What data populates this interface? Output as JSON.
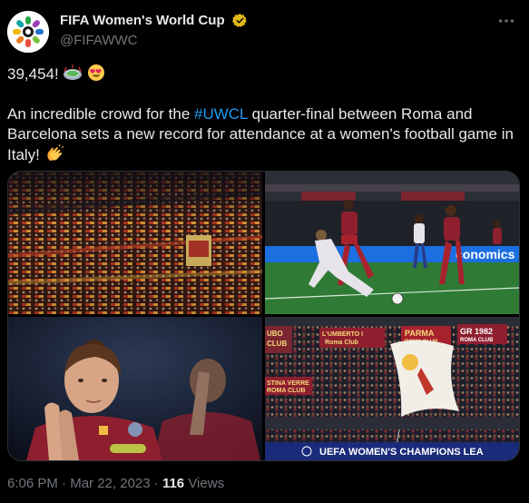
{
  "author": {
    "display_name": "FIFA Women's World Cup",
    "handle": "@FIFAWWC",
    "verified_color": "#e2b719"
  },
  "tweet": {
    "line1": "39,454!",
    "text_before": "An incredible crowd for the ",
    "hashtag": "#UWCL",
    "text_after": " quarter-final between Roma and Barcelona sets a new record for attendance at a women's football game in Italy!"
  },
  "images": {
    "ad_board_1": "conomics",
    "ad_board_2": "UEFA WOMEN'S CHAMPIONS LEA",
    "banner_1": "L'UMBERTO I\nRoma Club",
    "banner_2": "PARMA\nROMA CLUB",
    "banner_3": "GR 1982\nROMA CLUB",
    "banner_4": "UBO\nCLUB",
    "banner_5": "STINA VERRE\nROMA CLUB"
  },
  "footer": {
    "time": "6:06 PM",
    "separator": "·",
    "date": "Mar 22, 2023",
    "views_count": "116",
    "views_label": "Views"
  },
  "icons": [
    "verified-badge-icon",
    "more-options-icon",
    "stadium-emoji-icon",
    "heart-eyes-emoji-icon",
    "clapping-hands-emoji-icon",
    "uefa-starball-icon"
  ],
  "colors": {
    "background": "#000000",
    "text": "#e7e9ea",
    "muted": "#71767b",
    "link": "#1d9bf0",
    "roma": "#8e1f2f",
    "roma_gold": "#f0bc42"
  }
}
